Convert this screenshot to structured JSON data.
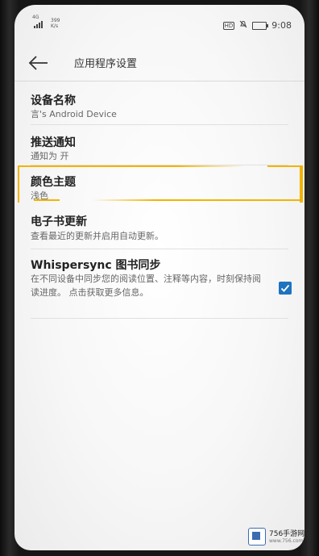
{
  "status_bar": {
    "network": "4G",
    "speed_value": "399",
    "speed_unit": "K/s",
    "time": "9:08",
    "hd_label": "HD"
  },
  "app_bar": {
    "title": "应用程序设置"
  },
  "settings": [
    {
      "title": "设备名称",
      "subtitle": "言's Android Device"
    },
    {
      "title": "推送通知",
      "subtitle": "通知为 开"
    },
    {
      "title": "颜色主题",
      "subtitle": "浅色"
    },
    {
      "title": "电子书更新",
      "subtitle": "查看最近的更新并启用自动更新。"
    },
    {
      "title": "Whispersync 图书同步",
      "subtitle": "在不同设备中同步您的阅读位置、注释等内容，时刻保持阅读进度。 点击获取更多信息。",
      "checked": true
    }
  ],
  "watermark": {
    "name": "756手游网",
    "url": "www.756.com"
  },
  "colors": {
    "highlight": "#f2b400",
    "checkbox": "#1e73be"
  }
}
